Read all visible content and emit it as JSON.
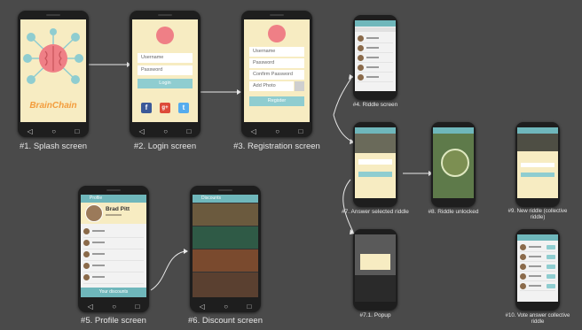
{
  "app": {
    "name": "BrainChain",
    "accent": "#8fcdd0",
    "screen_bg": "#f7ecc2",
    "brand_orange": "#f39c3c",
    "brain_pink": "#ef7f86"
  },
  "captions": [
    "#1. Splash screen",
    "#2. Login screen",
    "#3. Registration screen",
    "#4. Riddle screen",
    "#7. Answer selected riddle",
    "#8. Riddle unlocked",
    "#9. New riddle (collective riddle)",
    "#5. Profile screen",
    "#6. Discount screen",
    "#7.1. Popup",
    "#10. Vote answer collective riddle"
  ],
  "login": {
    "username_placeholder": "Username",
    "password_placeholder": "Password",
    "login_label": "Login",
    "social": [
      "f",
      "g+",
      "t"
    ]
  },
  "registration": {
    "username_placeholder": "Username",
    "password_placeholder": "Password",
    "confirm_placeholder": "Confirm Password",
    "add_photo_label": "Add Photo",
    "register_label": "Register"
  },
  "profile": {
    "title": "Profile",
    "user_name": "Brad Pitt",
    "footer_label": "Your discounts"
  },
  "discount": {
    "title": "Discounts"
  },
  "nav_glyphs": [
    "◁",
    "○",
    "□"
  ]
}
